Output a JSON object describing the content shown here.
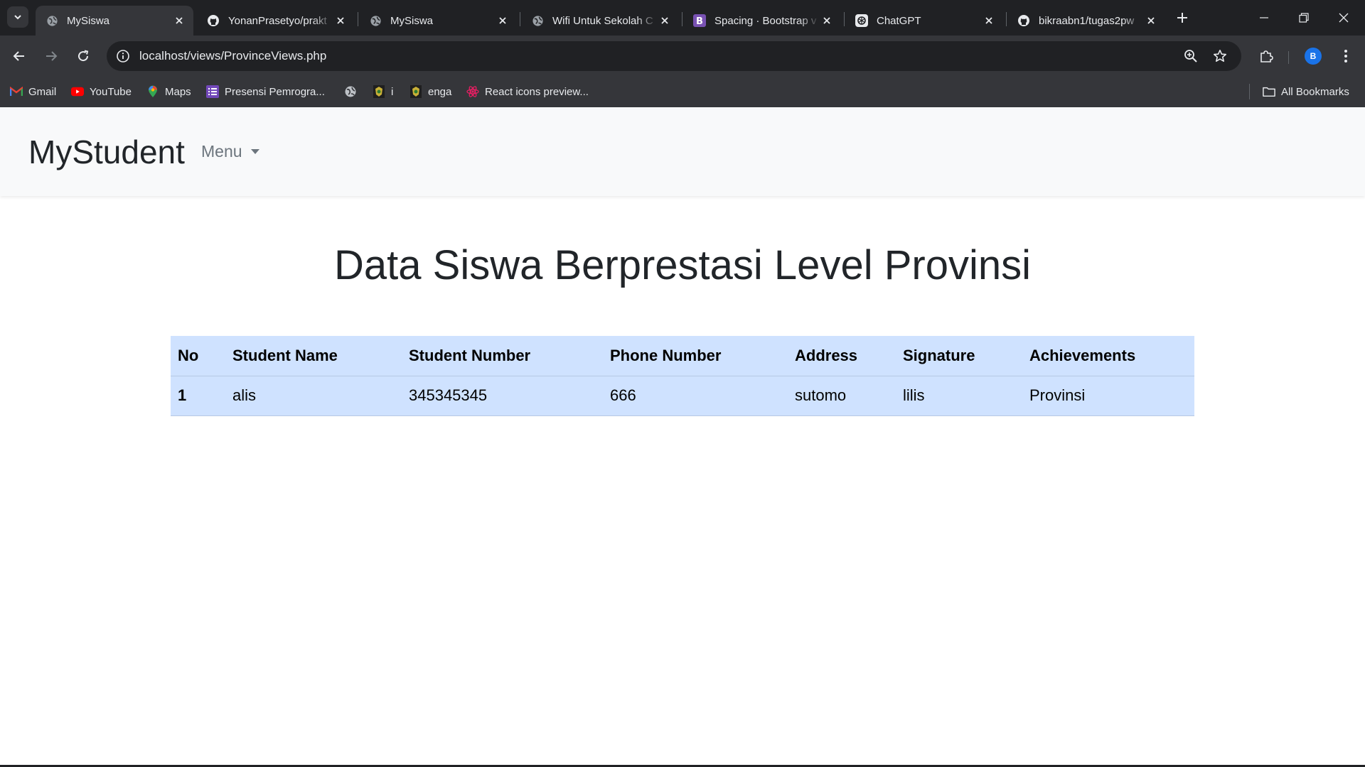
{
  "browser": {
    "tabs": [
      {
        "title": "MySiswa",
        "icon": "globe-icon",
        "active": true
      },
      {
        "title": "YonanPrasetyo/prakt",
        "icon": "github-icon",
        "active": false
      },
      {
        "title": "MySiswa",
        "icon": "globe-icon",
        "active": false
      },
      {
        "title": "Wifi Untuk Sekolah C",
        "icon": "globe-icon",
        "active": false
      },
      {
        "title": "Spacing · Bootstrap v",
        "icon": "bootstrap-icon",
        "active": false
      },
      {
        "title": "ChatGPT",
        "icon": "chatgpt-icon",
        "active": false
      },
      {
        "title": "bikraabn1/tugas2pw",
        "icon": "github-icon",
        "active": false
      }
    ],
    "url": "localhost/views/ProvinceViews.php",
    "profile_initial": "B",
    "bookmarks": [
      {
        "label": "Gmail",
        "icon": "gmail-icon"
      },
      {
        "label": "YouTube",
        "icon": "youtube-icon"
      },
      {
        "label": "Maps",
        "icon": "maps-icon"
      },
      {
        "label": "Presensi Pemrogra...",
        "icon": "list-icon"
      },
      {
        "label": "",
        "icon": "globe-icon"
      },
      {
        "label": "i",
        "icon": "crest-icon"
      },
      {
        "label": "enga",
        "icon": "crest-icon"
      },
      {
        "label": "React icons preview...",
        "icon": "react-icon"
      }
    ],
    "all_bookmarks_label": "All Bookmarks"
  },
  "navbar": {
    "brand": "MyStudent",
    "menu_label": "Menu"
  },
  "page": {
    "title": "Data Siswa Berprestasi Level Provinsi"
  },
  "table": {
    "headers": [
      "No",
      "Student Name",
      "Student Number",
      "Phone Number",
      "Address",
      "Signature",
      "Achievements"
    ],
    "rows": [
      [
        "1",
        "alis",
        "345345345",
        "666",
        "sutomo",
        "lilis",
        "Provinsi"
      ]
    ]
  },
  "colors": {
    "table_bg": "#cfe2ff",
    "navbar_bg": "#f8f9fa",
    "chrome_dark": "#202124",
    "chrome_toolbar": "#35363a"
  }
}
